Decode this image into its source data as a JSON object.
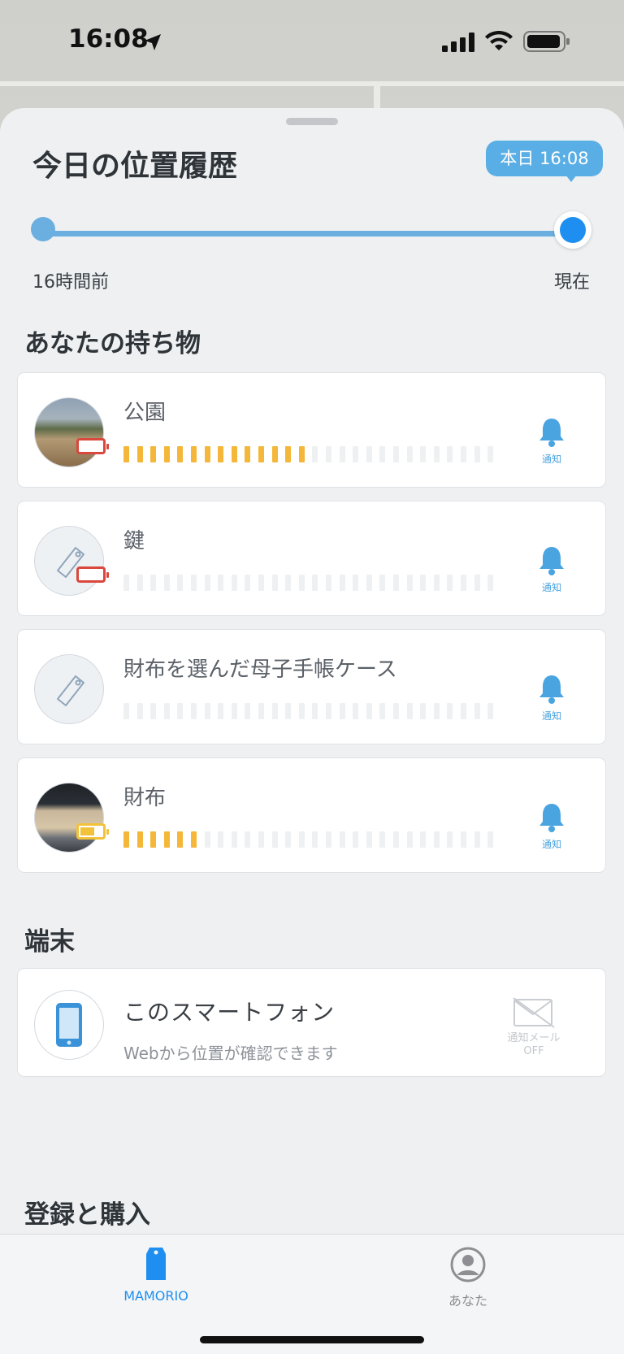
{
  "status_bar": {
    "time": "16:08"
  },
  "history": {
    "title": "今日の位置履歴",
    "badge": "本日 16:08",
    "slider_start_label": "16時間前",
    "slider_end_label": "現在"
  },
  "belongings": {
    "title": "あなたの持ち物",
    "items": [
      {
        "name": "公園",
        "signal_filled": 14,
        "signal_total": 28,
        "battery": "low",
        "bell_label": "通知",
        "avatar": "park-photo"
      },
      {
        "name": "鍵",
        "signal_filled": 0,
        "signal_total": 28,
        "battery": "low",
        "bell_label": "通知",
        "avatar": "tag-icon"
      },
      {
        "name": "財布を選んだ母子手帳ケース",
        "signal_filled": 0,
        "signal_total": 28,
        "battery": "none",
        "bell_label": "通知",
        "avatar": "tag-icon"
      },
      {
        "name": "財布",
        "signal_filled": 6,
        "signal_total": 28,
        "battery": "medium",
        "bell_label": "通知",
        "avatar": "wallet-photo"
      }
    ]
  },
  "devices": {
    "title": "端末",
    "phone": {
      "name": "このスマートフォン",
      "subtitle": "Webから位置が確認できます",
      "mail_label": "通知メール",
      "mail_status": "OFF"
    }
  },
  "register": {
    "title": "登録と購入"
  },
  "tabbar": {
    "tabs": [
      {
        "label": "MAMORIO",
        "active": true
      },
      {
        "label": "あなた",
        "active": false
      }
    ]
  },
  "colors": {
    "accent": "#1e8ff0",
    "signal_on": "#f4b73a",
    "signal_off": "#eef0f2",
    "battery_low": "#d9473d",
    "battery_mid": "#f2c23a"
  }
}
